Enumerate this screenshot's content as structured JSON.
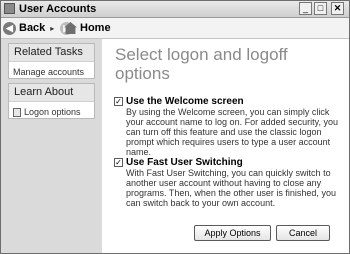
{
  "window": {
    "title": "User Accounts"
  },
  "title_buttons": {
    "minimize": "_",
    "maximize": "□",
    "close": "✕"
  },
  "toolbar": {
    "back_label": "Back",
    "home_label": "Home"
  },
  "sidebar": {
    "related_tasks": {
      "header": "Related Tasks",
      "items": [
        {
          "label": "Manage accounts"
        }
      ]
    },
    "learn_about": {
      "header": "Learn About",
      "items": [
        {
          "label": "Logon options"
        }
      ]
    }
  },
  "main": {
    "heading": "Select logon and logoff options",
    "options": [
      {
        "title": "Use the Welcome screen",
        "checked": true,
        "check_mark": "✓",
        "description": "By using the Welcome screen, you can simply click your account name to log on. For added security, you can turn off this feature and use the classic logon prompt which requires users to type a user account name."
      },
      {
        "title": "Use Fast User Switching",
        "checked": true,
        "check_mark": "✓",
        "description": "With Fast User Switching, you can quickly switch to another user account without having to close any programs. Then, when the other user is finished, you can switch back to your own account."
      }
    ],
    "buttons": {
      "apply": "Apply Options",
      "cancel": "Cancel"
    }
  }
}
